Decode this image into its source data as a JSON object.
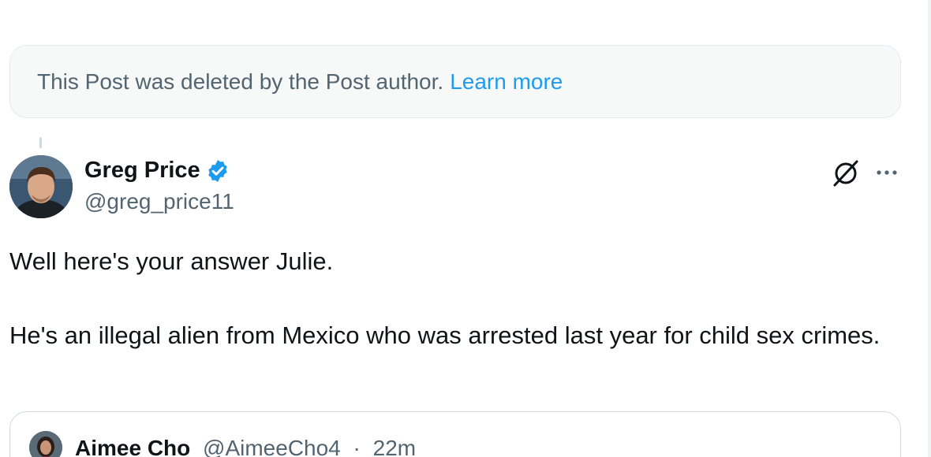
{
  "deleted_notice": {
    "text": "This Post was deleted by the Post author.",
    "link": "Learn more"
  },
  "post": {
    "author_name": "Greg Price",
    "author_handle": "@greg_price11",
    "verified": true,
    "body": [
      "Well here's your answer Julie.",
      "He's an illegal alien from Mexico who was arrested last year for child sex crimes."
    ],
    "icons": {
      "grok": "grok-icon",
      "more": "more-options-icon",
      "verified": "verified-badge-icon"
    }
  },
  "quoted_post": {
    "author_name": "Aimee Cho",
    "author_handle": "@AimeeCho4",
    "separator": "·",
    "time": "22m"
  },
  "colors": {
    "accent": "#1d9bf0",
    "secondary_text": "#536471",
    "primary_text": "#0f1419",
    "border": "#cfd9de"
  }
}
